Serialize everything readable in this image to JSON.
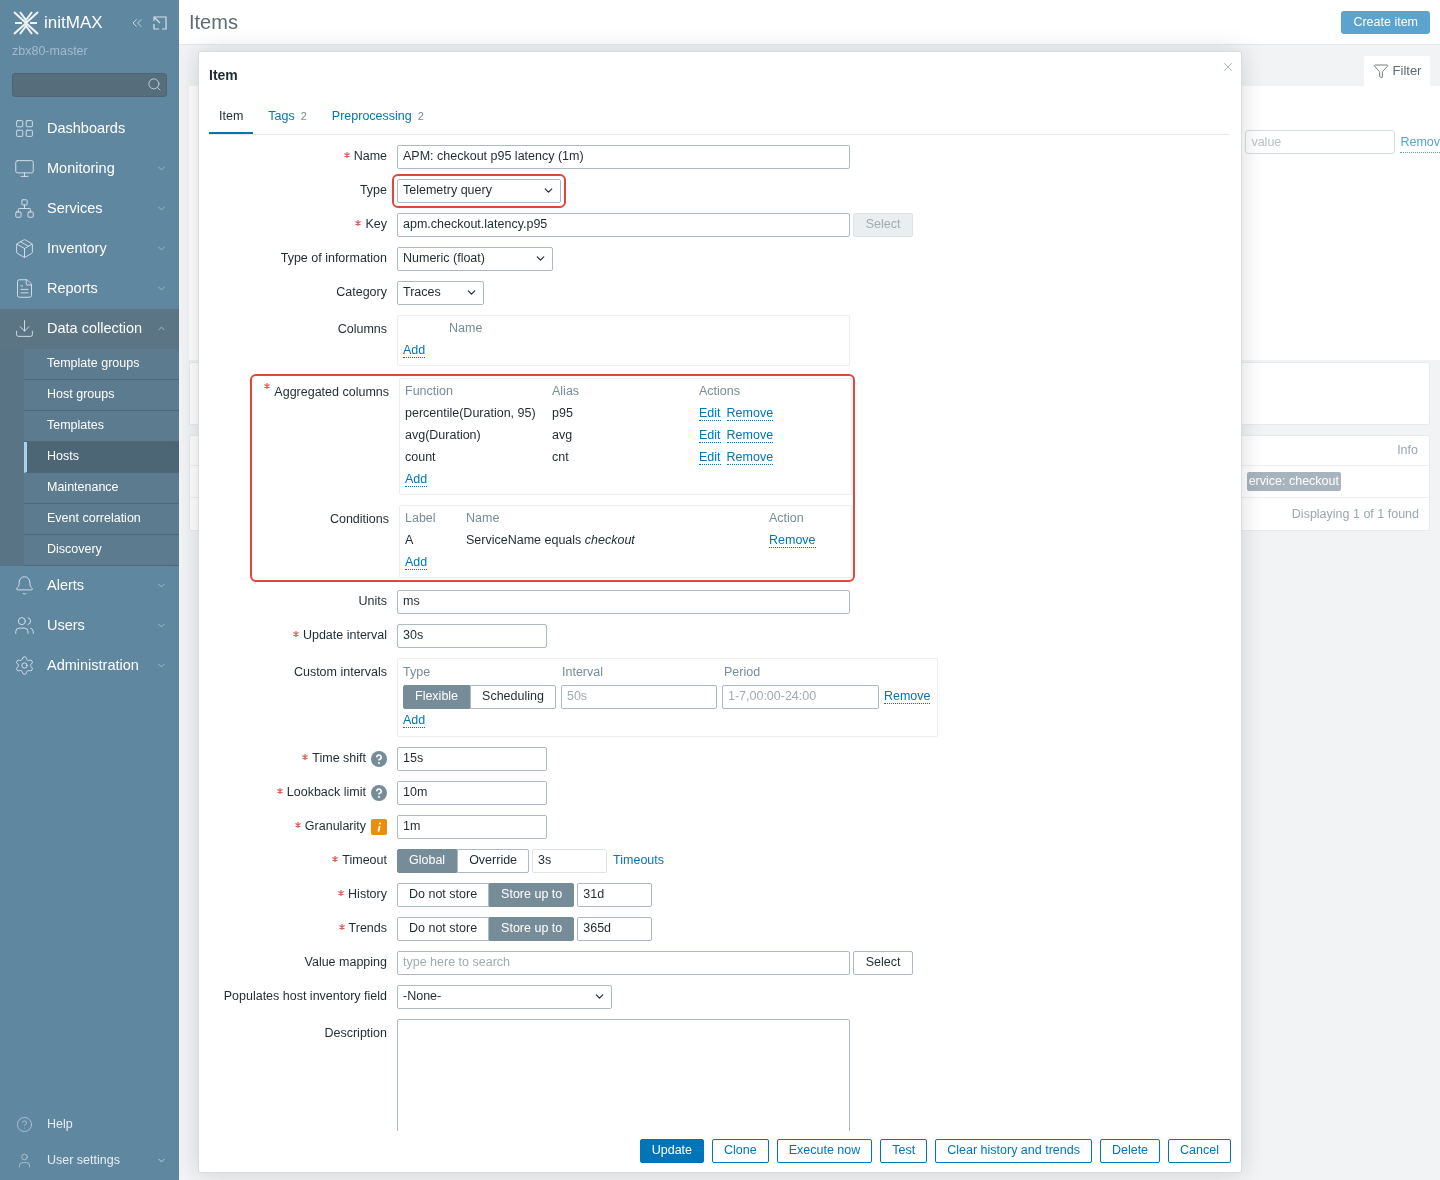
{
  "sidebar": {
    "brand": "initMAX",
    "server": "zbx80-master",
    "items": [
      {
        "label": "Dashboards",
        "kind": "link",
        "expanded": false
      },
      {
        "label": "Monitoring",
        "kind": "menu",
        "expanded": false
      },
      {
        "label": "Services",
        "kind": "menu",
        "expanded": false
      },
      {
        "label": "Inventory",
        "kind": "menu",
        "expanded": false
      },
      {
        "label": "Reports",
        "kind": "menu",
        "expanded": false
      },
      {
        "label": "Data collection",
        "kind": "menu",
        "expanded": true,
        "children": [
          {
            "label": "Template groups",
            "selected": false
          },
          {
            "label": "Host groups",
            "selected": false
          },
          {
            "label": "Templates",
            "selected": false
          },
          {
            "label": "Hosts",
            "selected": true
          },
          {
            "label": "Maintenance",
            "selected": false
          },
          {
            "label": "Event correlation",
            "selected": false
          },
          {
            "label": "Discovery",
            "selected": false
          }
        ]
      },
      {
        "label": "Alerts",
        "kind": "menu",
        "expanded": false
      },
      {
        "label": "Users",
        "kind": "menu",
        "expanded": false
      },
      {
        "label": "Administration",
        "kind": "menu",
        "expanded": false
      }
    ],
    "bottom": [
      {
        "label": "Help",
        "kind": "link"
      },
      {
        "label": "User settings",
        "kind": "menu"
      }
    ]
  },
  "page": {
    "title": "Items",
    "create_button": "Create item",
    "filter_tab": "Filter",
    "filter_value": {
      "placeholder": "value"
    },
    "filter_remove": "Remov",
    "info_header": "Info",
    "tag": "ervice: checkout",
    "footer": "Displaying 1 of 1 found"
  },
  "dialog": {
    "title": "Item",
    "tabs": [
      {
        "label": "Item",
        "selected": true
      },
      {
        "label": "Tags",
        "count": "2",
        "selected": false
      },
      {
        "label": "Preprocessing",
        "count": "2",
        "selected": false
      }
    ],
    "rows": [
      {
        "kind": "text",
        "label": "Name",
        "required": true,
        "value": "APM: checkout p95 latency (1m)"
      },
      {
        "kind": "select",
        "label": "Type",
        "required": false,
        "value": "Telemetry query",
        "highlighted": true
      },
      {
        "kind": "text_button",
        "label": "Key",
        "required": true,
        "value": "apm.checkout.latency.p95",
        "button": "Select",
        "disabled": true
      },
      {
        "kind": "select",
        "label": "Type of information",
        "required": false,
        "value": "Numeric (float)",
        "highlighted": false
      },
      {
        "kind": "select",
        "label": "Category",
        "required": false,
        "value": "Traces",
        "highlighted": false
      },
      {
        "kind": "table",
        "label": "Columns",
        "required": false,
        "highlighted": false,
        "headers": [
          "Name"
        ],
        "rows": [],
        "add": "Add"
      },
      {
        "kind": "table",
        "label": "Aggregated columns",
        "required": true,
        "highlighted": true,
        "headers": [
          "Function",
          "Alias",
          "Actions"
        ],
        "rows": [
          {
            "cells": [
              "percentile(Duration, 95)",
              "p95"
            ],
            "actions": [
              "Edit",
              "Remove"
            ]
          },
          {
            "cells": [
              "avg(Duration)",
              "avg"
            ],
            "actions": [
              "Edit",
              "Remove"
            ]
          },
          {
            "cells": [
              "count",
              "cnt"
            ],
            "actions": [
              "Edit",
              "Remove"
            ]
          }
        ],
        "add": "Add"
      },
      {
        "kind": "table",
        "label": "Conditions",
        "required": false,
        "highlighted": true,
        "headers": [
          "Label",
          "Name",
          "Action"
        ],
        "rows": [
          {
            "cells": [
              "A",
              "ServiceName equals *checkout*"
            ],
            "actions": [
              "Remove"
            ]
          }
        ],
        "add": "Add"
      },
      {
        "kind": "text",
        "label": "Units",
        "required": false,
        "value": "ms"
      },
      {
        "kind": "text",
        "label": "Update interval",
        "required": true,
        "value": "30s"
      },
      {
        "kind": "intervals",
        "label": "Custom intervals",
        "required": false,
        "headers": [
          "Type",
          "Interval",
          "Period"
        ],
        "rows": [
          {
            "options": [
              {
                "label": "Flexible",
                "selected": true
              },
              {
                "label": "Scheduling",
                "selected": false
              }
            ],
            "interval": {
              "placeholder": "50s"
            },
            "period": {
              "placeholder": "1-7,00:00-24:00"
            },
            "action": "Remove"
          }
        ],
        "add": "Add"
      },
      {
        "kind": "text",
        "label": "Time shift",
        "required": true,
        "help": true,
        "value": "15s"
      },
      {
        "kind": "text",
        "label": "Lookback limit",
        "required": true,
        "help": true,
        "value": "10m"
      },
      {
        "kind": "text",
        "label": "Granularity",
        "required": true,
        "warning": true,
        "value": "1m"
      },
      {
        "kind": "segmented",
        "label": "Timeout",
        "required": true,
        "options": [
          {
            "label": "Global",
            "selected": true
          },
          {
            "label": "Override",
            "selected": false
          }
        ],
        "value": "3s",
        "disabled": true,
        "link": "Timeouts"
      },
      {
        "kind": "segmented",
        "label": "History",
        "required": true,
        "options": [
          {
            "label": "Do not store",
            "selected": false
          },
          {
            "label": "Store up to",
            "selected": true
          }
        ],
        "value": "31d",
        "disabled": false
      },
      {
        "kind": "segmented",
        "label": "Trends",
        "required": true,
        "options": [
          {
            "label": "Do not store",
            "selected": false
          },
          {
            "label": "Store up to",
            "selected": true
          }
        ],
        "value": "365d",
        "disabled": false
      },
      {
        "kind": "text_button",
        "label": "Value mapping",
        "required": false,
        "placeholder": "type here to search",
        "button": "Select",
        "disabled": false
      },
      {
        "kind": "select",
        "label": "Populates host inventory field",
        "required": false,
        "value": "-None-",
        "highlighted": false
      },
      {
        "kind": "textarea",
        "label": "Description",
        "required": false
      }
    ],
    "buttons": [
      {
        "label": "Update",
        "primary": true
      },
      {
        "label": "Clone",
        "primary": false
      },
      {
        "label": "Execute now",
        "primary": false
      },
      {
        "label": "Test",
        "primary": false
      },
      {
        "label": "Clear history and trends",
        "primary": false
      },
      {
        "label": "Delete",
        "primary": false
      },
      {
        "label": "Cancel",
        "primary": false
      }
    ]
  }
}
